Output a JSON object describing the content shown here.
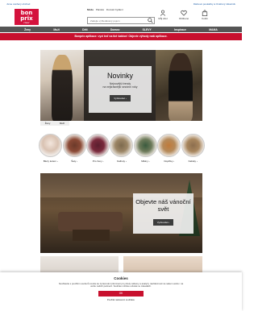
{
  "topbar": {
    "left": "Jsme ověřený obchod",
    "right": "Dárkové poukázky ● Ověřený zákazník"
  },
  "header": {
    "logo": {
      "line1": "bon",
      "line2": "prix",
      "line3": "clear"
    },
    "tabs": [
      "Móda",
      "Pánská",
      "Domácí bydlení"
    ],
    "search": {
      "placeholder": "Zadejte vyhledávaný pojem"
    },
    "icons": [
      {
        "name": "account-icon",
        "label": "Můj účet"
      },
      {
        "name": "heart-icon",
        "label": "Oblíbené"
      },
      {
        "name": "cart-icon",
        "label": "Košík"
      }
    ]
  },
  "nav": [
    "Ženy",
    "Muži",
    "Děti",
    "Domov",
    "SLEVY",
    "Inspirace",
    "MAMA"
  ],
  "promo": {
    "text": "Bonprix aplikace: vyzi teď na tbě šablon! Objevte výhody naší aplikace."
  },
  "hero": {
    "title": "Novinky",
    "text": "Nejnovější trendy\nna nejkrásnější sezónní roky",
    "button": "Vyzkoušet ›",
    "subtabs": [
      "Ženy",
      "Muži"
    ]
  },
  "categories": [
    {
      "label": "Bluzy kolem ›"
    },
    {
      "label": "Šaty ›"
    },
    {
      "label": "Pro ženy ›"
    },
    {
      "label": "Kalhoty ›"
    },
    {
      "label": "Mikiny ›"
    },
    {
      "label": "Doplňky ›"
    },
    {
      "label": "Kabáty ›"
    }
  ],
  "xmas": {
    "title": "Objevte náš vánoční svět",
    "button": "Vyzkoušet ›"
  },
  "cookie": {
    "title": "Cookies",
    "text": "Souhlasíte s použitím souborů cookie ke zpracování informací pro účely reklamy a analýzy návštěvnosti na našem webu i na webu našich partnerů. Souhlas můžete odvolat ve zásadách.",
    "accept": "OK",
    "settings": "Použitá nastavení souhlasu"
  },
  "colors": {
    "brand": "#c8102e",
    "nav": "#555555"
  }
}
